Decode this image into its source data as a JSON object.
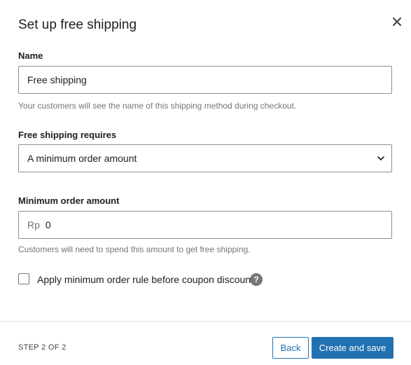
{
  "modal": {
    "title": "Set up free shipping",
    "close_icon": "close-icon"
  },
  "name_field": {
    "label": "Name",
    "value": "Free shipping",
    "help": "Your customers will see the name of this shipping method during checkout."
  },
  "requires_field": {
    "label": "Free shipping requires",
    "selected": "A minimum order amount",
    "icon": "chevron-down-icon"
  },
  "minimum_field": {
    "label": "Minimum order amount",
    "prefix": "Rp",
    "value": "0",
    "help": "Customers will need to spend this amount to get free shipping."
  },
  "coupon_rule": {
    "label": "Apply minimum order rule before coupon discount",
    "checked": false,
    "help_icon_text": "?"
  },
  "footer": {
    "step": "STEP 2 OF 2",
    "back_label": "Back",
    "create_label": "Create and save"
  },
  "colors": {
    "primary": "#2271b1",
    "text": "#1e1e1e",
    "muted": "#757575",
    "border": "#8c8f94"
  }
}
